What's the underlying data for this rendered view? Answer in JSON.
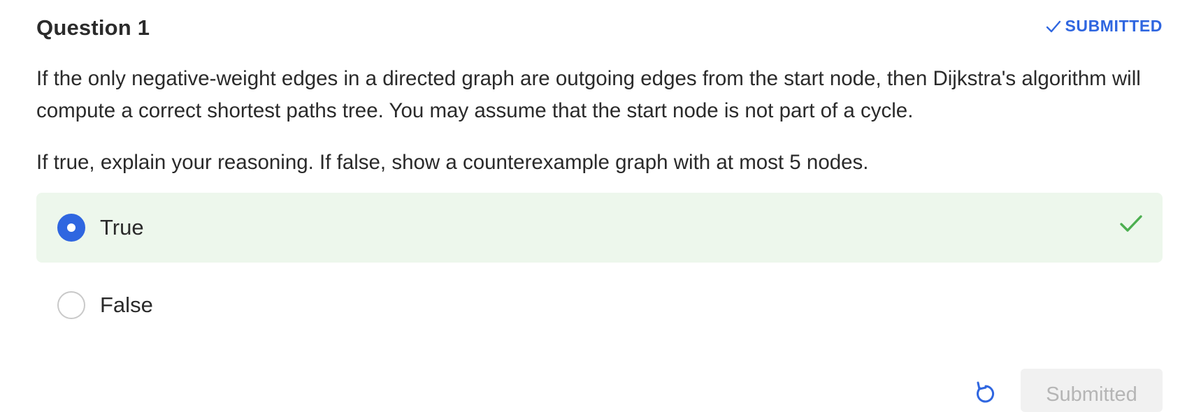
{
  "question": {
    "title": "Question 1",
    "status_label": "SUBMITTED",
    "prompt_text": "If the only negative-weight edges in a directed graph are outgoing edges from the start node, then Dijkstra's algorithm will compute a correct shortest paths tree. You may assume that the start node is not part of a cycle.",
    "instruction_text": "If true, explain your reasoning. If false, show a counterexample graph with at most 5 nodes.",
    "options": [
      {
        "label": "True",
        "selected": true,
        "correct": true
      },
      {
        "label": "False",
        "selected": false,
        "correct": false
      }
    ]
  },
  "footer": {
    "submit_label": "Submitted",
    "reset_icon": "reset-icon"
  },
  "colors": {
    "accent": "#2f66e0",
    "correct": "#4caf50",
    "selected_bg": "#edf7ec",
    "disabled_text": "#b5b5b5",
    "disabled_bg": "#f1f1f1"
  },
  "icons": {
    "status": "check-icon",
    "correct": "check-icon",
    "reset": "rotate-ccw-icon"
  }
}
